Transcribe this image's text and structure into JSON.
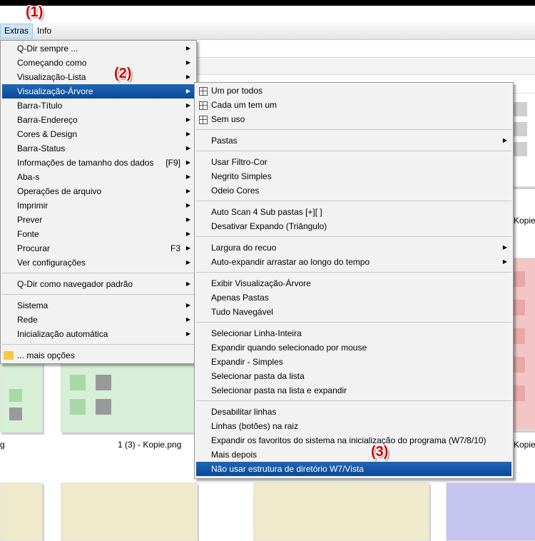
{
  "menubar": {
    "extras": "Extras",
    "info": "Info"
  },
  "annotations": [
    "(1)",
    "(2)",
    "(3)"
  ],
  "extras_menu": [
    {
      "label": "Q-Dir sempre ...",
      "submenu": true
    },
    {
      "label": "Começando como",
      "submenu": true
    },
    {
      "label": "Visualização-Lista",
      "submenu": true
    },
    {
      "label": "Visualização-Árvore",
      "submenu": true,
      "highlighted": true
    },
    {
      "label": "Barra-Título",
      "submenu": true
    },
    {
      "label": "Barra-Endereço",
      "submenu": true
    },
    {
      "label": "Cores & Design",
      "submenu": true
    },
    {
      "label": "Barra-Status",
      "submenu": true
    },
    {
      "label": "Informações de tamanho dos dados",
      "shortcut": "[F9]",
      "submenu": true
    },
    {
      "label": "Aba-s",
      "submenu": true
    },
    {
      "label": "Operações de arquivo",
      "submenu": true
    },
    {
      "label": "Imprimir",
      "submenu": true
    },
    {
      "label": "Prever",
      "submenu": true
    },
    {
      "label": "Fonte",
      "submenu": true
    },
    {
      "label": "Procurar",
      "shortcut": "F3",
      "submenu": true
    },
    {
      "label": "Ver configurações",
      "submenu": true
    },
    {
      "label": "Q-Dir como navegador padrão",
      "submenu": true
    },
    {
      "label": "Sistema",
      "submenu": true
    },
    {
      "label": "Rede",
      "submenu": true
    },
    {
      "label": "Inicialização automática",
      "submenu": true
    },
    {
      "label": "... mais opções",
      "icon": "folder-icon"
    }
  ],
  "tree_menu": [
    {
      "label": "Um por todos",
      "icon": "tree-icon"
    },
    {
      "label": "Cada um tem um",
      "icon": "tree-icon"
    },
    {
      "label": "Sem uso",
      "icon": "tree-icon"
    },
    {
      "label": "Pastas",
      "submenu": true
    },
    {
      "label": "Usar Filtro-Cor"
    },
    {
      "label": "Negrito Simples"
    },
    {
      "label": "Odeio Cores"
    },
    {
      "label": "Auto Scan 4 Sub pastas [+][ ]"
    },
    {
      "label": "Desativar Expando (Triângulo)"
    },
    {
      "label": "Largura do recuo",
      "submenu": true
    },
    {
      "label": "Auto-expandir arrastar ao longo do tempo",
      "submenu": true
    },
    {
      "label": "Exibir Visualização-Árvore"
    },
    {
      "label": "Apenas Pastas"
    },
    {
      "label": "Tudo Navegável"
    },
    {
      "label": "Selecionar Linha-Inteira"
    },
    {
      "label": "Expandir quando selecionado por mouse"
    },
    {
      "label": "Expandir - Simples"
    },
    {
      "label": "Selecionar pasta da lista"
    },
    {
      "label": "Selecionar pasta na lista e expandir"
    },
    {
      "label": "Desabilitar linhas"
    },
    {
      "label": "Linhas (botões) na raiz"
    },
    {
      "label": "Expandir os favoritos do sistema na inicialização do programa (W7/8/10)"
    },
    {
      "label": "Mais depois"
    },
    {
      "label": "Não usar estrutura de diretório W7/Vista",
      "highlighted": true
    }
  ],
  "captions": {
    "c1": "Kopie",
    "c2": "1 (3) - Kopie.png",
    "c3": "Kopie",
    "c4": "g"
  },
  "colors": {
    "highlight": "#0b4a98",
    "annotation": "#cc0000"
  }
}
